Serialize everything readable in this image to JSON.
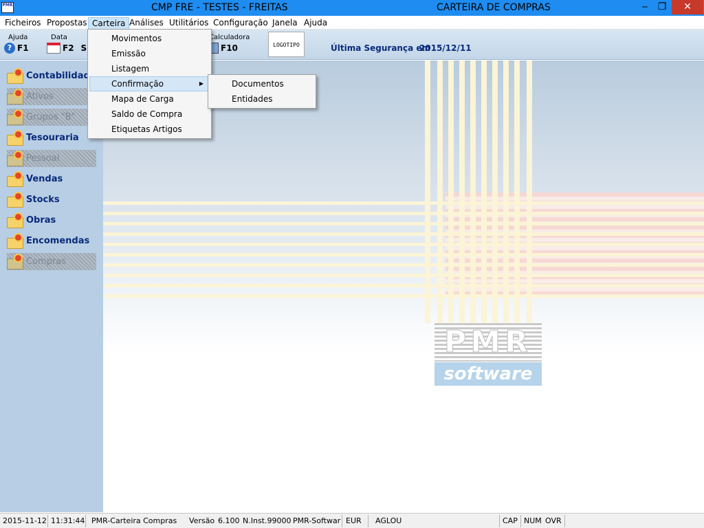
{
  "titlebar": {
    "app_icon": "PMR",
    "title": "CMP FRE - TESTES - FREITAS",
    "module": "CARTEIRA DE COMPRAS",
    "minimize": "‒",
    "maximize": "❐",
    "close": "✕"
  },
  "menu": {
    "items": [
      "Ficheiros",
      "Propostas",
      "Carteira",
      "Análises",
      "Utilitários",
      "Configuração",
      "Janela",
      "Ajuda"
    ],
    "active": "Carteira"
  },
  "toolbar": {
    "help_label": "Ajuda",
    "help_key": "F1",
    "help_icon": "?",
    "date_label": "Data",
    "date_key": "F2",
    "date_partial": "S",
    "calc_label": "Calculadora",
    "calc_key": "F10",
    "logo_text": "LOGOTIPO",
    "backup_label": "Última Segurança em",
    "backup_date": "2015/12/11"
  },
  "carteira_menu": {
    "items": [
      "Movimentos",
      "Emissão",
      "Listagem",
      "Confirmação",
      "Mapa de Carga",
      "Saldo de Compra",
      "Etiquetas Artigos"
    ],
    "highlighted": "Confirmação",
    "submenu_arrow": "▶"
  },
  "confirmacao_submenu": {
    "items": [
      "Documentos",
      "Entidades"
    ]
  },
  "sidebar": {
    "items": [
      {
        "label": "Contabilidade",
        "enabled": true
      },
      {
        "label": "Ativos",
        "enabled": false
      },
      {
        "label": "Grupos \"B\"",
        "enabled": false
      },
      {
        "label": "Tesouraria",
        "enabled": true
      },
      {
        "label": "Pessoal",
        "enabled": false
      },
      {
        "label": "Vendas",
        "enabled": true
      },
      {
        "label": "Stocks",
        "enabled": true
      },
      {
        "label": "Obras",
        "enabled": true
      },
      {
        "label": "Encomendas",
        "enabled": true
      },
      {
        "label": "Compras",
        "enabled": false
      }
    ]
  },
  "branding": {
    "brand_top": "PMR",
    "brand_bottom": "software"
  },
  "statusbar": {
    "date": "2015-11-12",
    "time": "11:31:44",
    "module": "PMR-Carteira Compras",
    "version_label": "Versão",
    "version": "6.100",
    "install": "N.Inst.99000",
    "vendor": "PMR-Softwar",
    "currency": "EUR",
    "user": "AGLOU",
    "cap": "CAP",
    "num": "NUM",
    "ovr": "OVR"
  },
  "colors": {
    "titlebar": "#1e8cf0",
    "sidebar": "#b8cee4",
    "sidebar_text": "#0a2a7a",
    "close_button": "#c7392b",
    "menu_highlight": "#d5e6f7"
  }
}
